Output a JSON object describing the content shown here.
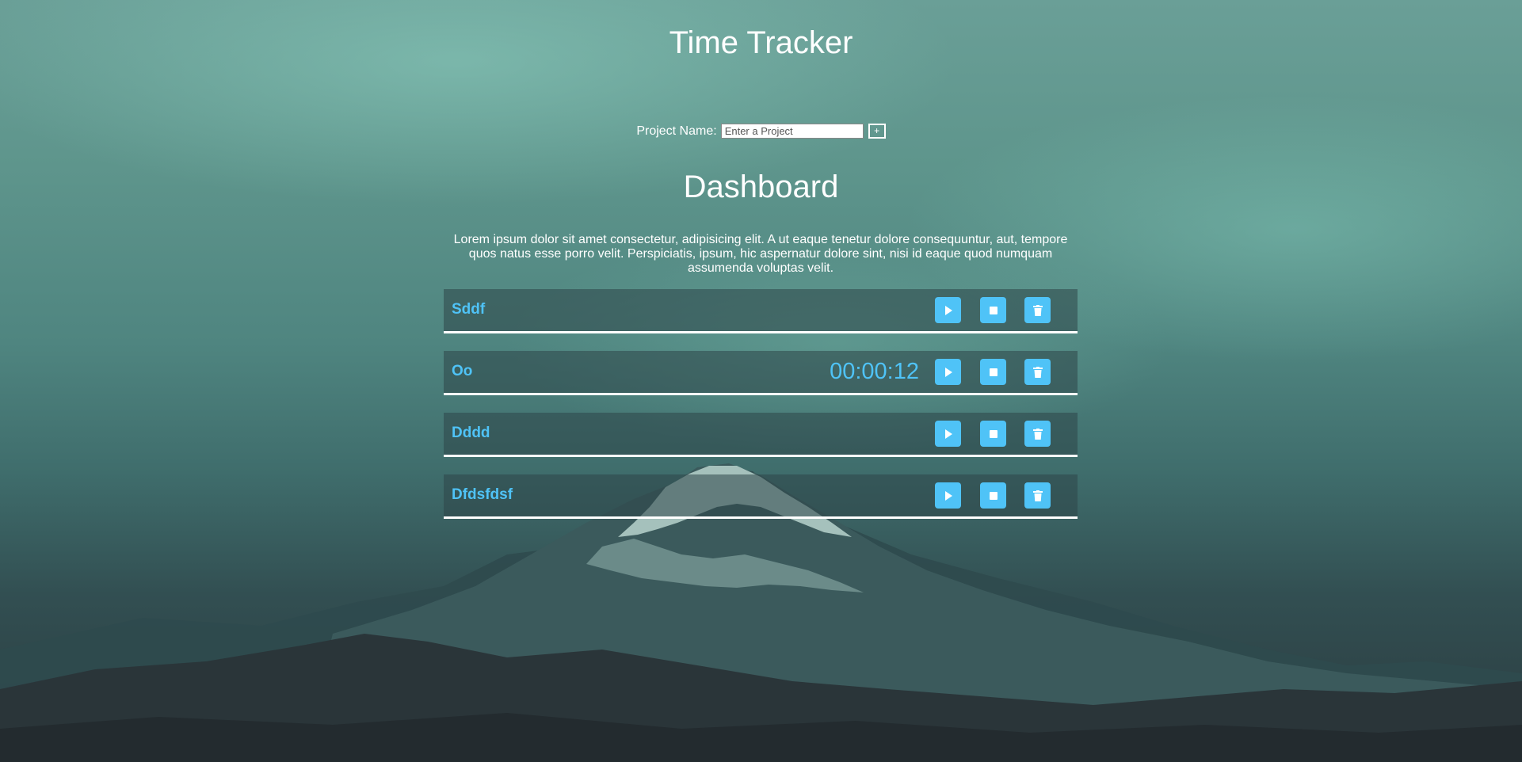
{
  "header": {
    "title": "Time Tracker"
  },
  "project_form": {
    "label": "Project Name:",
    "input_value": "",
    "input_placeholder": "Enter a Project",
    "add_button_label": "+"
  },
  "dashboard": {
    "title": "Dashboard",
    "description": "Lorem ipsum dolor sit amet consectetur, adipisicing elit. A ut eaque tenetur dolore consequuntur, aut, tempore quos natus esse porro velit. Perspiciatis, ipsum, hic aspernatur dolore sint, nisi id eaque quod numquam assumenda voluptas velit."
  },
  "projects": [
    {
      "name": "Sddf",
      "timer": ""
    },
    {
      "name": "Oo",
      "timer": "00:00:12"
    },
    {
      "name": "Dddd",
      "timer": ""
    },
    {
      "name": "Dfdsfdsf",
      "timer": ""
    }
  ],
  "icons": {
    "play": "play-icon",
    "stop": "stop-icon",
    "delete": "trash-icon"
  },
  "colors": {
    "accent": "#4fc3f7",
    "text": "#ffffff",
    "row_background": "rgba(45,70,72,0.55)"
  }
}
